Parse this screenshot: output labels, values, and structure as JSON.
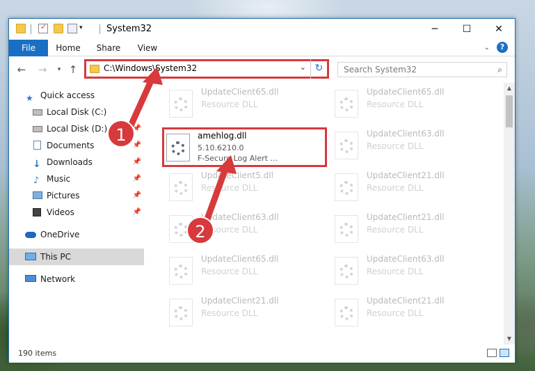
{
  "window": {
    "title": "System32"
  },
  "ribbon": {
    "tabs": [
      "File",
      "Home",
      "Share",
      "View"
    ],
    "help": "?"
  },
  "address": {
    "path": "C:\\Windows\\System32",
    "search_placeholder": "Search System32"
  },
  "nav": {
    "items": [
      {
        "label": "Quick access",
        "icon": "star-icon"
      },
      {
        "label": "Local Disk (C:)",
        "icon": "drive-icon"
      },
      {
        "label": "Local Disk (D:)",
        "icon": "drive-icon"
      },
      {
        "label": "Documents",
        "icon": "documents-icon"
      },
      {
        "label": "Downloads",
        "icon": "download-icon"
      },
      {
        "label": "Music",
        "icon": "music-icon"
      },
      {
        "label": "Pictures",
        "icon": "pictures-icon"
      },
      {
        "label": "Videos",
        "icon": "videos-icon"
      },
      {
        "label": "OneDrive",
        "icon": "cloud-icon"
      },
      {
        "label": "This PC",
        "icon": "computer-icon"
      },
      {
        "label": "Network",
        "icon": "network-icon"
      }
    ]
  },
  "files": {
    "faded": [
      {
        "name": "UpdateClient65.dll",
        "desc": "Resource DLL"
      },
      {
        "name": "UpdateClient65.dll",
        "desc": "Resource DLL"
      },
      {
        "name": "UpdateClient63.dll",
        "desc": "Resource DLL"
      },
      {
        "name": "UpdateClient5.dll",
        "desc": "Resource DLL"
      },
      {
        "name": "UpdateClient21.dll",
        "desc": "Resource DLL"
      },
      {
        "name": "UpdateClient63.dll",
        "desc": "Resource DLL"
      },
      {
        "name": "UpdateClient21.dll",
        "desc": "Resource DLL"
      },
      {
        "name": "UpdateClient65.dll",
        "desc": "Resource DLL"
      },
      {
        "name": "UpdateClient63.dll",
        "desc": "Resource DLL"
      },
      {
        "name": "UpdateClient21.dll",
        "desc": "Resource DLL"
      },
      {
        "name": "UpdateClient21.dll",
        "desc": "Resource DLL"
      }
    ],
    "highlighted": {
      "name": "amehlog.dll",
      "version": "5.10.6210.0",
      "desc": "F-Secure Log Alert ..."
    }
  },
  "status": {
    "items": "190 items"
  },
  "callouts": [
    "1",
    "2"
  ],
  "colors": {
    "accent": "#1a6fc4",
    "highlight": "#d7393c"
  }
}
